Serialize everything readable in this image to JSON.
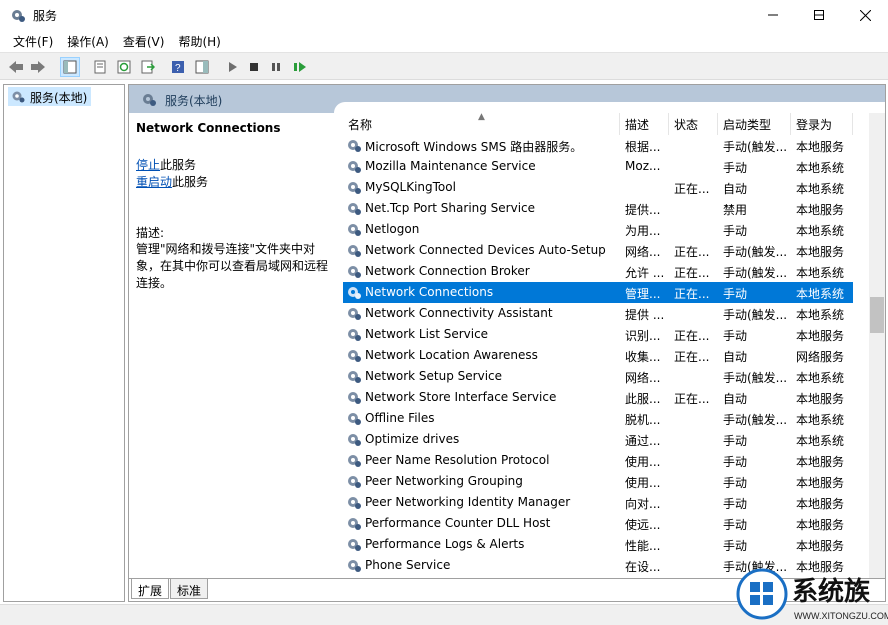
{
  "window": {
    "title": "服务"
  },
  "menu": [
    "文件(F)",
    "操作(A)",
    "查看(V)",
    "帮助(H)"
  ],
  "tree": {
    "root_label": "服务(本地)"
  },
  "content_header": "服务(本地)",
  "description_panel": {
    "service_title": "Network Connections",
    "stop_link": "停止",
    "stop_suffix": "此服务",
    "restart_link": "重启动",
    "restart_suffix": "此服务",
    "desc_label": "描述:",
    "desc_text": "管理\"网络和拨号连接\"文件夹中对象，在其中你可以查看局域网和远程连接。"
  },
  "columns": [
    "名称",
    "描述",
    "状态",
    "启动类型",
    "登录为"
  ],
  "services": [
    {
      "name": "Microsoft Windows SMS 路由器服务。",
      "desc": "根据...",
      "status": "",
      "startup": "手动(触发...",
      "logon": "本地服务"
    },
    {
      "name": "Mozilla Maintenance Service",
      "desc": "Moz...",
      "status": "",
      "startup": "手动",
      "logon": "本地系统"
    },
    {
      "name": "MySQLKingTool",
      "desc": "",
      "status": "正在...",
      "startup": "自动",
      "logon": "本地系统"
    },
    {
      "name": "Net.Tcp Port Sharing Service",
      "desc": "提供...",
      "status": "",
      "startup": "禁用",
      "logon": "本地服务"
    },
    {
      "name": "Netlogon",
      "desc": "为用...",
      "status": "",
      "startup": "手动",
      "logon": "本地系统"
    },
    {
      "name": "Network Connected Devices Auto-Setup",
      "desc": "网络...",
      "status": "正在...",
      "startup": "手动(触发...",
      "logon": "本地服务"
    },
    {
      "name": "Network Connection Broker",
      "desc": "允许 ...",
      "status": "正在...",
      "startup": "手动(触发...",
      "logon": "本地系统"
    },
    {
      "name": "Network Connections",
      "desc": "管理...",
      "status": "正在...",
      "startup": "手动",
      "logon": "本地系统",
      "selected": true
    },
    {
      "name": "Network Connectivity Assistant",
      "desc": "提供 ...",
      "status": "",
      "startup": "手动(触发...",
      "logon": "本地系统"
    },
    {
      "name": "Network List Service",
      "desc": "识别...",
      "status": "正在...",
      "startup": "手动",
      "logon": "本地服务"
    },
    {
      "name": "Network Location Awareness",
      "desc": "收集...",
      "status": "正在...",
      "startup": "自动",
      "logon": "网络服务"
    },
    {
      "name": "Network Setup Service",
      "desc": "网络...",
      "status": "",
      "startup": "手动(触发...",
      "logon": "本地系统"
    },
    {
      "name": "Network Store Interface Service",
      "desc": "此服...",
      "status": "正在...",
      "startup": "自动",
      "logon": "本地服务"
    },
    {
      "name": "Offline Files",
      "desc": "脱机...",
      "status": "",
      "startup": "手动(触发...",
      "logon": "本地系统"
    },
    {
      "name": "Optimize drives",
      "desc": "通过...",
      "status": "",
      "startup": "手动",
      "logon": "本地系统"
    },
    {
      "name": "Peer Name Resolution Protocol",
      "desc": "使用...",
      "status": "",
      "startup": "手动",
      "logon": "本地服务"
    },
    {
      "name": "Peer Networking Grouping",
      "desc": "使用...",
      "status": "",
      "startup": "手动",
      "logon": "本地服务"
    },
    {
      "name": "Peer Networking Identity Manager",
      "desc": "向对...",
      "status": "",
      "startup": "手动",
      "logon": "本地服务"
    },
    {
      "name": "Performance Counter DLL Host",
      "desc": "使远...",
      "status": "",
      "startup": "手动",
      "logon": "本地服务"
    },
    {
      "name": "Performance Logs & Alerts",
      "desc": "性能...",
      "status": "",
      "startup": "手动",
      "logon": "本地服务"
    },
    {
      "name": "Phone Service",
      "desc": "在设...",
      "status": "",
      "startup": "手动(触发...",
      "logon": "本地服务"
    }
  ],
  "tabs": [
    "扩展",
    "标准"
  ],
  "watermark": {
    "text": "系统族",
    "url": "WWW.XITONGZU.COM"
  },
  "colors": {
    "selection": "#0078d7",
    "header_band": "#b7c7d9",
    "link": "#0050b4"
  }
}
